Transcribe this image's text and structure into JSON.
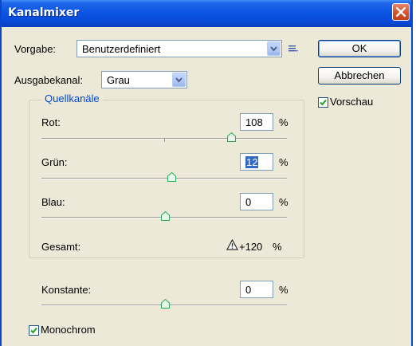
{
  "window": {
    "title": "Kanalmixer"
  },
  "preset": {
    "label": "Vorgabe:",
    "value": "Benutzerdefiniert"
  },
  "output_channel": {
    "label": "Ausgabekanal:",
    "value": "Grau"
  },
  "buttons": {
    "ok": "OK",
    "cancel": "Abbrechen"
  },
  "preview": {
    "label": "Vorschau",
    "checked": true
  },
  "source_channels": {
    "legend": "Quellkanäle",
    "percent_sign": "%",
    "red": {
      "label": "Rot:",
      "value": "108",
      "min": -200,
      "max": 200,
      "level": 108
    },
    "green": {
      "label": "Grün:",
      "value": "12",
      "min": -200,
      "max": 200,
      "level": 12
    },
    "blue": {
      "label": "Blau:",
      "value": "0",
      "min": -200,
      "max": 200,
      "level": 0
    },
    "total": {
      "label": "Gesamt:",
      "value": "+120",
      "unit": "%"
    }
  },
  "constant": {
    "label": "Konstante:",
    "value": "0",
    "percent_sign": "%",
    "min": -200,
    "max": 200,
    "level": 0
  },
  "monochrome": {
    "label": "Monochrom",
    "checked": true
  },
  "colors": {
    "title_bar": "#0a54e3",
    "close_button": "#d8542f",
    "dialog_bg": "#ece9d8",
    "legend_text": "#0046d5",
    "check_mark": "#21a121",
    "slider_thumb": "#2eaa5c",
    "selection": "#316ac5"
  },
  "icons": [
    "close-icon",
    "dropdown-arrow-icon",
    "preset-menu-icon",
    "check-icon",
    "slider-thumb-icon",
    "warning-icon"
  ]
}
